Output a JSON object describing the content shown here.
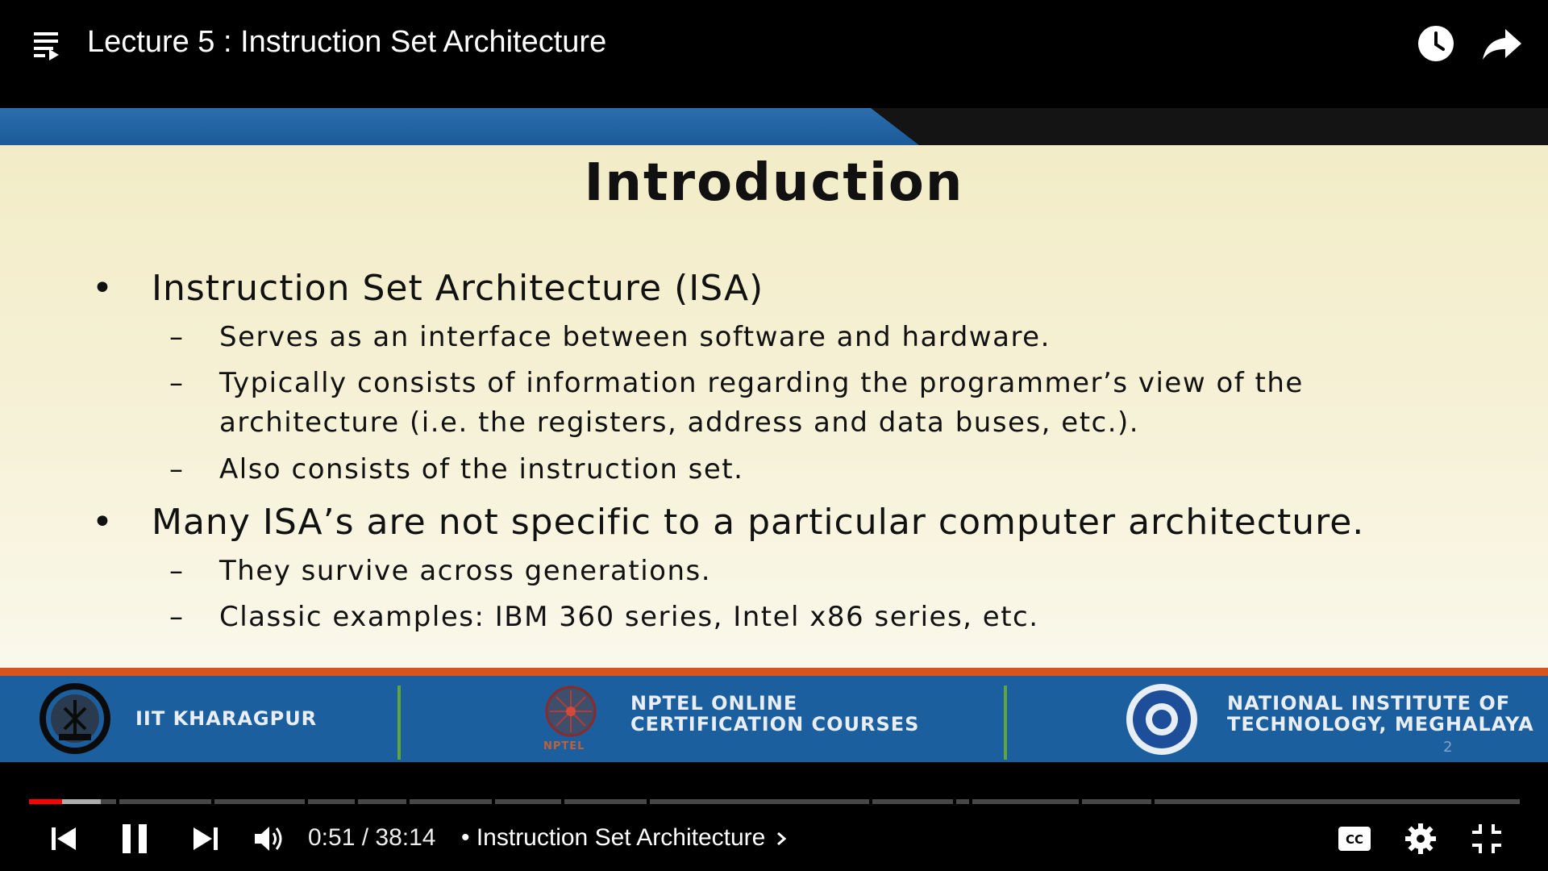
{
  "header": {
    "title": "Lecture 5 : Instruction Set Architecture"
  },
  "slide": {
    "title": "Introduction",
    "bullets": [
      {
        "text": "Instruction Set Architecture (ISA)",
        "subs": [
          "Serves as an interface between software and hardware.",
          "Typically consists of information regarding the programmer’s view of the",
          "architecture (i.e. the registers, address and data buses, etc.).",
          "Also consists of the instruction set."
        ]
      },
      {
        "text": "Many ISA’s are not specific to a particular computer architecture.",
        "subs": [
          "They survive across generations.",
          "Classic examples: IBM 360 series, Intel x86 series, etc."
        ]
      }
    ],
    "bullet_mark": "•",
    "dash_mark": "–",
    "page_number": "2",
    "footer": {
      "left": "IIT KHARAGPUR",
      "center_line1": "NPTEL ONLINE",
      "center_line2": "CERTIFICATION COURSES",
      "center_logo_caption": "NPTEL",
      "right_line1": "NATIONAL INSTITUTE OF",
      "right_line2": "TECHNOLOGY, MEGHALAYA"
    }
  },
  "player": {
    "current_time": "0:51",
    "duration": "38:14",
    "time_text": "0:51 / 38:14",
    "chapter_text": "• Instruction Set Architecture",
    "played_fraction": 0.022,
    "loaded_fraction": 0.048,
    "icons": {
      "playlist": "playlist-icon",
      "watch_later": "clock-icon",
      "share": "share-arrow-icon",
      "previous": "skip-previous-icon",
      "pause": "pause-icon",
      "next": "skip-next-icon",
      "volume": "volume-icon",
      "chapter_chevron": "chevron-right-icon",
      "captions": "cc-icon",
      "settings": "gear-icon",
      "exit_fullscreen": "exit-fullscreen-icon"
    },
    "colors": {
      "played": "#ff0000",
      "slide_blue": "#1b5f9e",
      "slide_accent": "#d8541f"
    }
  }
}
